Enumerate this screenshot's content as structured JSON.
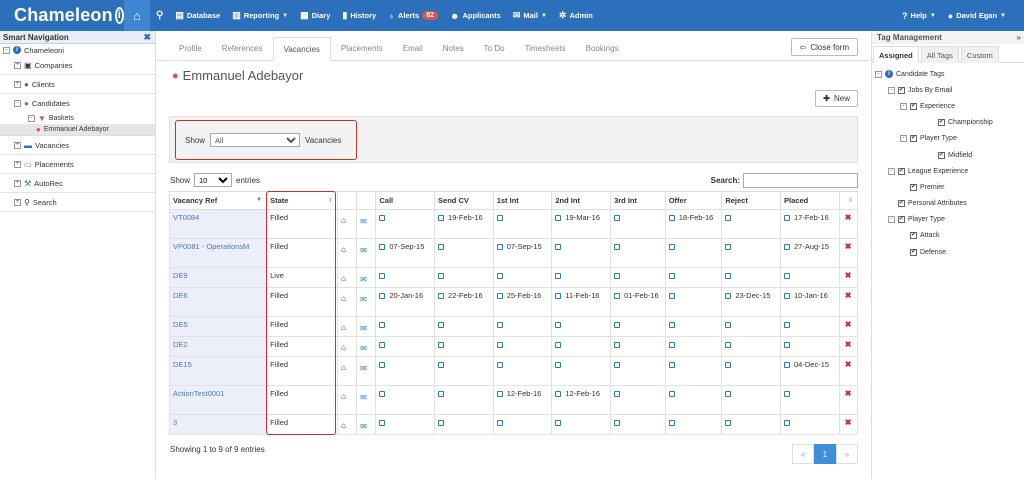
{
  "app": {
    "logo": "Chameleon",
    "logo_mark": "i"
  },
  "topnav": {
    "items": [
      {
        "label": "Database",
        "icon": "table-icon"
      },
      {
        "label": "Reporting",
        "icon": "bar-chart-icon",
        "dropdown": true
      },
      {
        "label": "Diary",
        "icon": "calendar-icon"
      },
      {
        "label": "History",
        "icon": "book-icon"
      },
      {
        "label": "Alerts",
        "icon": "lightbulb-icon",
        "badge": "82"
      },
      {
        "label": "Applicants",
        "icon": "users-icon"
      },
      {
        "label": "Mail",
        "icon": "envelope-icon",
        "dropdown": true
      },
      {
        "label": "Admin",
        "icon": "cogs-icon"
      }
    ],
    "help_label": "Help",
    "user_label": "David Egan",
    "colors": {
      "bar": "#2c6fbb",
      "home": "#3f86d2",
      "badge": "#d9534f"
    }
  },
  "left_nav": {
    "title": "Smart Navigation",
    "root": "Chameleoni",
    "items": [
      {
        "label": "Companies",
        "icon": "building-icon"
      },
      {
        "label": "Clients",
        "icon": "user-icon"
      },
      {
        "label": "Candidates",
        "icon": "users-icon"
      }
    ],
    "baskets": "Baskets",
    "current": "Emmanuel Adebayor",
    "items2": [
      {
        "label": "Vacancies",
        "icon": "briefcase-icon"
      },
      {
        "label": "Placements",
        "icon": "money-icon"
      },
      {
        "label": "AutoRec",
        "icon": "wrench-icon"
      },
      {
        "label": "Search",
        "icon": "search-icon"
      }
    ]
  },
  "main": {
    "tabs": [
      "Profile",
      "References",
      "Vacancies",
      "Placements",
      "Email",
      "Notes",
      "To Do",
      "Timesheets",
      "Bookings"
    ],
    "active_tab": 2,
    "close_label": "Close form",
    "title": "Emmanuel Adebayor",
    "new_label": "New",
    "filter": {
      "show_label": "Show",
      "selected": "All",
      "suffix": "Vacancies"
    },
    "entries": {
      "show": "Show",
      "count": "10",
      "suffix": "entries"
    },
    "search_label": "Search:",
    "columns": [
      "Vacancy Ref",
      "State",
      "",
      "",
      "Call",
      "Send CV",
      "1st Int",
      "2nd Int",
      "3rd Int",
      "Offer",
      "Reject",
      "Placed",
      ""
    ],
    "rows": [
      {
        "ref": "VT0084",
        "state": "Filled",
        "call": "",
        "send_cv": "19-Feb-16",
        "int1": "",
        "int2": "19-Mar-16",
        "int3": "",
        "offer": "18-Feb-16",
        "reject": "",
        "placed": "17-Feb-16"
      },
      {
        "ref": "VP0081 - OperationsM",
        "state": "Filled",
        "call": "07-Sep-15",
        "send_cv": "",
        "int1": "07-Sep-15",
        "int2": "",
        "int3": "",
        "offer": "",
        "reject": "",
        "placed": "27-Aug-15"
      },
      {
        "ref": "DE9",
        "state": "Live",
        "call": "",
        "send_cv": "",
        "int1": "",
        "int2": "",
        "int3": "",
        "offer": "",
        "reject": "",
        "placed": ""
      },
      {
        "ref": "DE6",
        "state": "Filled",
        "call": "20-Jan-16",
        "send_cv": "22-Feb-16",
        "int1": "25-Feb-16",
        "int2": "11-Feb-16",
        "int3": "01-Feb-16",
        "offer": "",
        "reject": "23-Dec-15",
        "placed": "10-Jan-16"
      },
      {
        "ref": "DE5",
        "state": "Filled",
        "call": "",
        "send_cv": "",
        "int1": "",
        "int2": "",
        "int3": "",
        "offer": "",
        "reject": "",
        "placed": ""
      },
      {
        "ref": "DE2",
        "state": "Filled",
        "call": "",
        "send_cv": "",
        "int1": "",
        "int2": "",
        "int3": "",
        "offer": "",
        "reject": "",
        "placed": ""
      },
      {
        "ref": "DE15",
        "state": "Filled",
        "call": "",
        "send_cv": "",
        "int1": "",
        "int2": "",
        "int3": "",
        "offer": "",
        "reject": "",
        "placed": "04-Dec-15"
      },
      {
        "ref": "ActionTest0001",
        "state": "Filled",
        "call": "",
        "send_cv": "",
        "int1": "12-Feb-16",
        "int2": "12-Feb-16",
        "int3": "",
        "offer": "",
        "reject": "",
        "placed": ""
      },
      {
        "ref": "3",
        "state": "Filled",
        "call": "",
        "send_cv": "",
        "int1": "",
        "int2": "",
        "int3": "",
        "offer": "",
        "reject": "",
        "placed": ""
      }
    ],
    "info": "Showing 1 to 9 of 9 entries",
    "pager": {
      "prev": "«",
      "page": "1",
      "next": "»"
    }
  },
  "tag_panel": {
    "title": "Tag Management",
    "tabs": [
      "Assigned",
      "All Tags",
      "Custom"
    ],
    "tags": [
      {
        "label": "Candidate Tags",
        "level": 0,
        "expander": "-",
        "info": true
      },
      {
        "label": "Jobs By Email",
        "level": 1,
        "expander": "-",
        "checked": true
      },
      {
        "label": "Experience",
        "level": 2,
        "expander": "-",
        "checked": true
      },
      {
        "label": "Championship",
        "level": 3,
        "checked": true
      },
      {
        "label": "Player Type",
        "level": 2,
        "expander": "-",
        "checked": true
      },
      {
        "label": "Midfield",
        "level": 3,
        "checked": true
      },
      {
        "label": "League Experience",
        "level": 1,
        "expander": "-",
        "checked": true
      },
      {
        "label": "Premier",
        "level": 2,
        "checked": true
      },
      {
        "label": "Personal Attributes",
        "level": 1,
        "checked": true
      },
      {
        "label": "Player Type",
        "level": 1,
        "expander": "-",
        "checked": true
      },
      {
        "label": "Attack",
        "level": 2,
        "checked": true
      },
      {
        "label": "Defense",
        "level": 2,
        "checked": true
      }
    ]
  }
}
